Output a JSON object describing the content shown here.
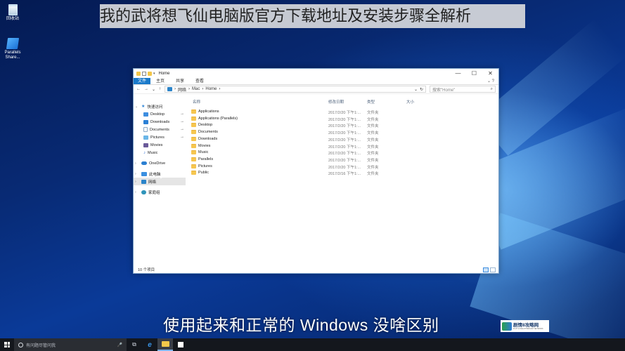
{
  "overlay": {
    "title_banner": "我的武将想飞仙电脑版官方下载地址及安装步骤全解析",
    "subtitle": "使用起来和正常的 Windows 没啥区别",
    "watermark": {
      "name": "剧情8攻略网",
      "tagline": "PLOT & WALKTHROUGH NETWORK"
    }
  },
  "desktop": {
    "icons": [
      {
        "label": "回收站",
        "icon": "recycle-bin-icon"
      },
      {
        "label": "Parallels Share...",
        "icon": "parallels-share-icon"
      }
    ]
  },
  "explorer": {
    "title": "Home",
    "window_controls": {
      "minimize": "—",
      "maximize": "☐",
      "close": "✕"
    },
    "ribbon_tabs": [
      "文件",
      "主页",
      "共享",
      "查看"
    ],
    "ribbon_expand": "⌄ ?",
    "nav_buttons": {
      "back": "←",
      "forward": "→",
      "recent": "⌄",
      "up": "↑"
    },
    "address_path": [
      "网络",
      "Mac",
      "Home"
    ],
    "address_sep": "›",
    "address_dropdown": "⌄",
    "address_refresh": "↻",
    "search_placeholder": "搜索\"Home\"",
    "columns": {
      "name": "名称",
      "date": "修改日期",
      "type": "类型",
      "size": "大小"
    },
    "sidebar": {
      "quick_access": "快速访问",
      "quick_items": [
        {
          "label": "Desktop",
          "icon": "desktop-icon",
          "pinned": true
        },
        {
          "label": "Downloads",
          "icon": "downloads-icon",
          "pinned": true
        },
        {
          "label": "Documents",
          "icon": "documents-icon",
          "pinned": true
        },
        {
          "label": "Pictures",
          "icon": "pictures-icon",
          "pinned": true
        },
        {
          "label": "Movies",
          "icon": "movies-icon",
          "pinned": false
        },
        {
          "label": "Music",
          "icon": "music-icon",
          "pinned": false
        }
      ],
      "onedrive": "OneDrive",
      "this_pc": "此电脑",
      "network": "网络",
      "homegroup": "家庭组",
      "pin_glyph": "📌"
    },
    "files": [
      {
        "name": "Applications",
        "date": "2017/2/20 下午1:...",
        "type": "文件夹"
      },
      {
        "name": "Applications (Parallels)",
        "date": "2017/2/20 下午1:...",
        "type": "文件夹"
      },
      {
        "name": "Desktop",
        "date": "2017/2/20 下午1:...",
        "type": "文件夹"
      },
      {
        "name": "Documents",
        "date": "2017/2/20 下午1:...",
        "type": "文件夹"
      },
      {
        "name": "Downloads",
        "date": "2017/2/20 下午1:...",
        "type": "文件夹"
      },
      {
        "name": "Movies",
        "date": "2017/2/20 下午1:...",
        "type": "文件夹"
      },
      {
        "name": "Music",
        "date": "2017/2/20 下午1:...",
        "type": "文件夹"
      },
      {
        "name": "Parallels",
        "date": "2017/2/20 下午1:...",
        "type": "文件夹"
      },
      {
        "name": "Pictures",
        "date": "2017/2/20 下午1:...",
        "type": "文件夹"
      },
      {
        "name": "Public",
        "date": "2017/2/16 下午1:...",
        "type": "文件夹"
      }
    ],
    "status": "10 个项目"
  },
  "taskbar": {
    "search_placeholder": "有问题尽管问我",
    "mic": "🎤",
    "task_view": "⧉",
    "edge": "e"
  }
}
